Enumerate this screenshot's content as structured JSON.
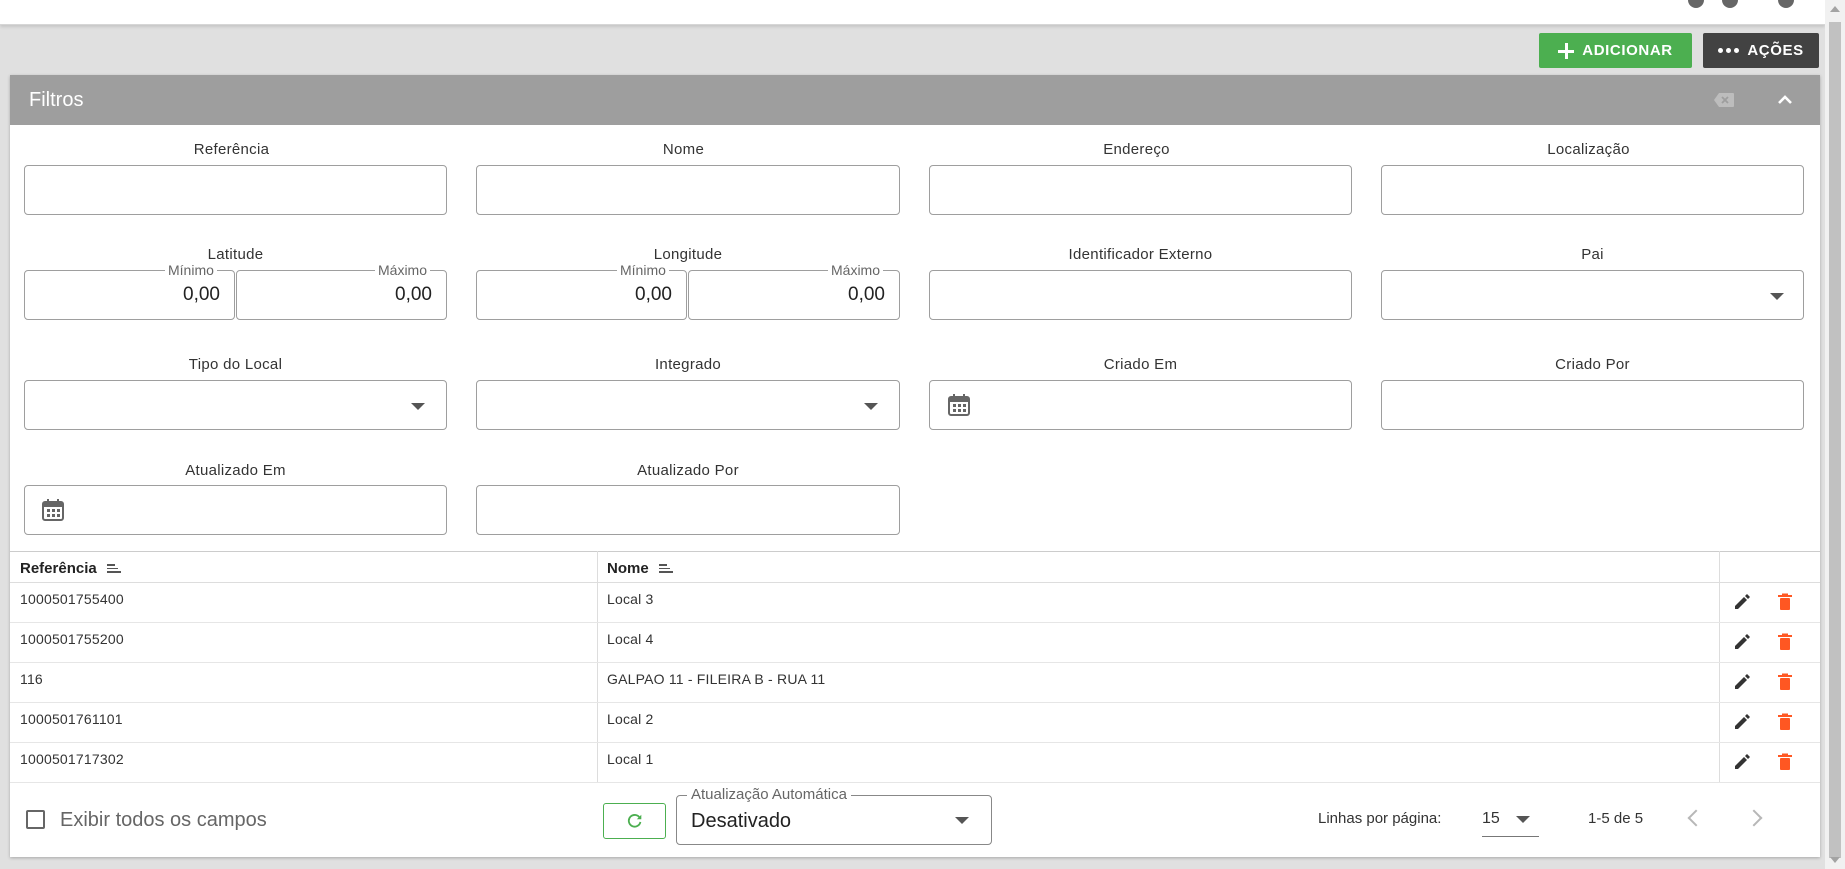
{
  "toolbar": {
    "add_label": "ADICIONAR",
    "actions_label": "AÇÕES"
  },
  "filters": {
    "title": "Filtros",
    "referencia": "Referência",
    "nome": "Nome",
    "endereco": "Endereço",
    "localizacao": "Localização",
    "latitude": "Latitude",
    "longitude": "Longitude",
    "minimo": "Mínimo",
    "maximo": "Máximo",
    "lat_min": "0,00",
    "lat_max": "0,00",
    "lon_min": "0,00",
    "lon_max": "0,00",
    "identificador_externo": "Identificador Externo",
    "pai": "Pai",
    "tipo_do_local": "Tipo do Local",
    "integrado": "Integrado",
    "criado_em": "Criado Em",
    "criado_por": "Criado Por",
    "atualizado_em": "Atualizado Em",
    "atualizado_por": "Atualizado Por"
  },
  "table": {
    "columns": [
      "Referência",
      "Nome"
    ],
    "rows": [
      {
        "referencia": "1000501755400",
        "nome": "Local 3"
      },
      {
        "referencia": "1000501755200",
        "nome": "Local 4"
      },
      {
        "referencia": "116",
        "nome": "GALPAO 11 - FILEIRA B - RUA 11"
      },
      {
        "referencia": "1000501761101",
        "nome": "Local 2"
      },
      {
        "referencia": "1000501717302",
        "nome": "Local 1"
      }
    ]
  },
  "footer": {
    "show_all_fields": "Exibir todos os campos",
    "auto_update_label": "Atualização Automática",
    "auto_update_value": "Desativado",
    "rows_per_page_label": "Linhas por página:",
    "rows_per_page_value": "15",
    "range": "1-5 de 5"
  },
  "colors": {
    "add_button": "#4caf50",
    "actions_button": "#424242",
    "filter_header": "#9e9e9e",
    "delete_icon": "#ff5722"
  }
}
